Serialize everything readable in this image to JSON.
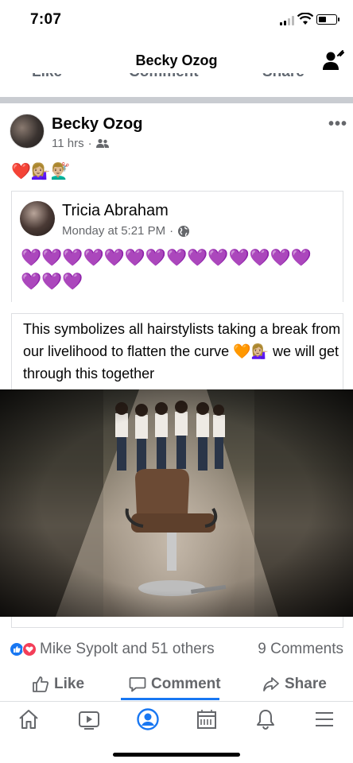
{
  "status_bar": {
    "time": "7:07"
  },
  "header": {
    "title": "Becky Ozog",
    "profile_icon": "person-plus-icon"
  },
  "prev_actions": {
    "like": "Like",
    "comment": "Comment",
    "share": "Share"
  },
  "post": {
    "author": "Becky Ozog",
    "time": "11 hrs",
    "privacy_icon": "friends-icon",
    "more_label": "•••",
    "emoji": "❤️💁🏼‍♀️💇🏼‍♂️"
  },
  "shared": {
    "author": "Tricia Abraham",
    "time": "Monday at 5:21 PM",
    "privacy_icon": "globe-icon",
    "hearts": "💜💜💜💜💜💜💜💜💜💜💜💜💜💜💜💜💜",
    "text": "This symbolizes all hairstylists taking a break from our livelihood to flatten the curve 🧡💁🏼‍♀️ we will get through this together"
  },
  "reactions": {
    "summary": "Mike Sypolt and 51 others",
    "comments": "9 Comments",
    "like_color": "#1877f2",
    "love_color": "#f33e58"
  },
  "actions": {
    "like": "Like",
    "comment": "Comment",
    "share": "Share"
  },
  "nav": {
    "items": [
      "home-icon",
      "watch-icon",
      "profile-icon",
      "marketplace-icon",
      "notifications-icon",
      "menu-icon"
    ],
    "active": "profile-icon",
    "accent": "#1877f2"
  }
}
